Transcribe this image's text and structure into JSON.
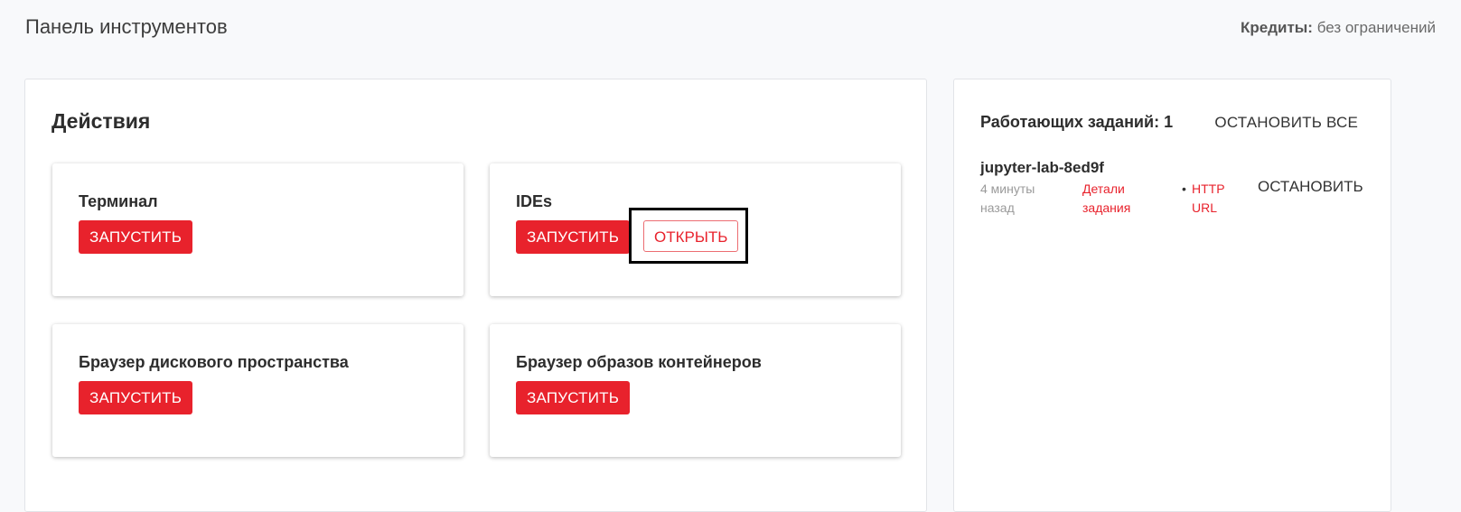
{
  "header": {
    "title": "Панель инструментов",
    "credits_label": "Кредиты:",
    "credits_value": "без ограничений"
  },
  "actions": {
    "heading": "Действия",
    "cards": [
      {
        "title": "Терминал",
        "launch_label": "ЗАПУСТИТЬ"
      },
      {
        "title": "IDEs",
        "launch_label": "ЗАПУСТИТЬ",
        "open_label": "ОТКРЫТЬ"
      },
      {
        "title": "Браузер дискового пространства",
        "launch_label": "ЗАПУСТИТЬ"
      },
      {
        "title": "Браузер образов контейнеров",
        "launch_label": "ЗАПУСТИТЬ"
      }
    ]
  },
  "jobs": {
    "heading": "Работающих заданий: 1",
    "stop_all_label": "ОСТАНОВИТЬ ВСЕ",
    "items": [
      {
        "name": "jupyter-lab-8ed9f",
        "time": "4 минуты назад",
        "details_label": "Детали задания",
        "bullet": "•",
        "url_label": "HTTP URL",
        "stop_label": "ОСТАНОВИТЬ"
      }
    ]
  },
  "colors": {
    "accent": "#e8222c",
    "background": "#f8f9fb",
    "highlight_border": "#000000"
  }
}
